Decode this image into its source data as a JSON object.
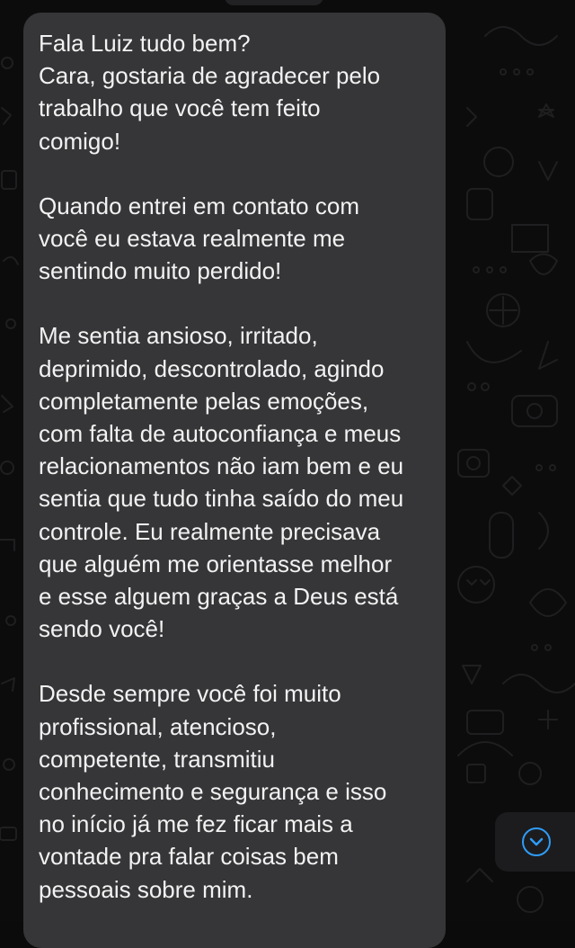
{
  "chat": {
    "message": {
      "paragraphs": [
        "Fala Luiz tudo bem?\nCara, gostaria de agradecer pelo\ntrabalho que você tem feito\ncomigo!",
        "Quando entrei em contato com\nvocê eu estava realmente me\nsentindo muito perdido!",
        "Me sentia ansioso, irritado,\ndeprimido, descontrolado, agindo\ncompletamente pelas emoções,\ncom falta de autoconfiança e meus\nrelacionamentos não iam bem e eu\nsentia que tudo tinha saído do meu\ncontrole. Eu realmente precisava\nque alguém me orientasse melhor\ne esse alguem graças a Deus está\nsendo você!",
        "Desde sempre você foi muito\nprofissional, atencioso,\ncompetente, transmitiu\nconhecimento e segurança e isso\nno início já me fez ficar mais a\nvontade pra falar coisas bem\npessoais sobre mim."
      ]
    },
    "scroll_button": {
      "icon": "chevron-down-icon",
      "accent_color": "#2f9cf7"
    },
    "colors": {
      "background": "#0c0c0c",
      "bubble": "#363638",
      "text": "#f2f2f2"
    }
  }
}
